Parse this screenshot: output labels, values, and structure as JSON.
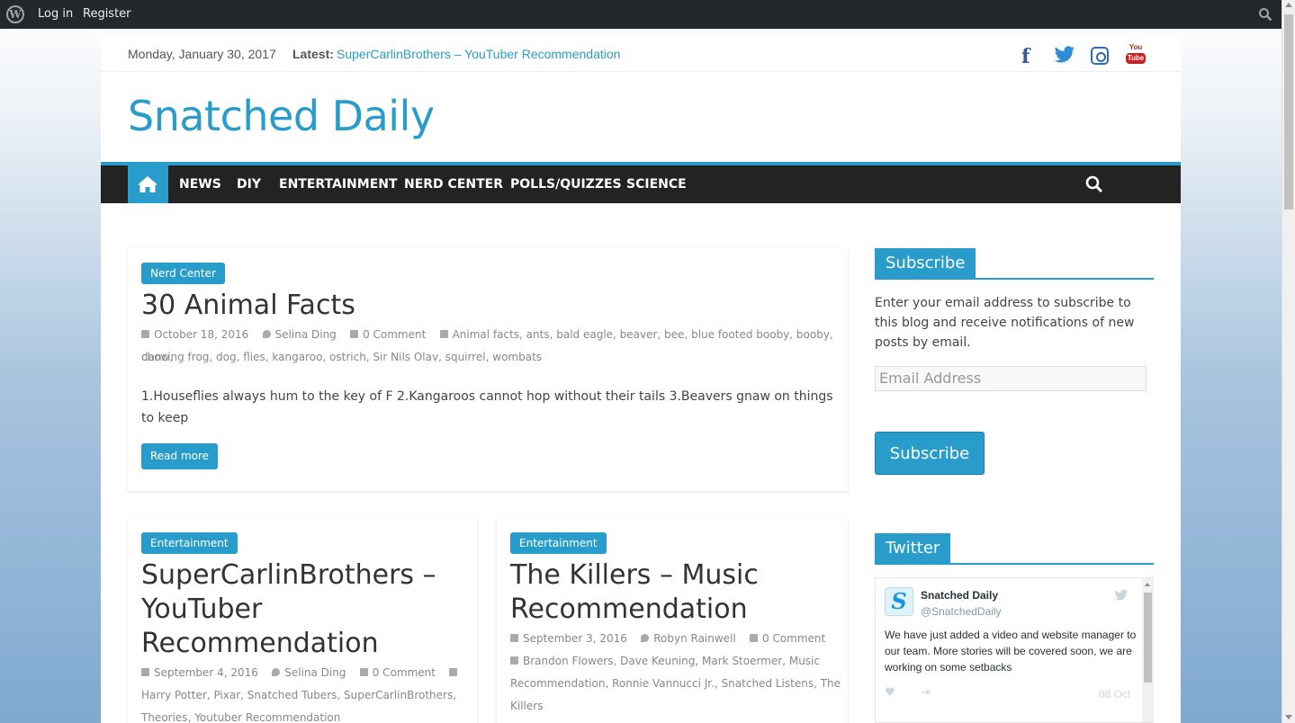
{
  "admin_bar": {
    "login": "Log in",
    "register": "Register"
  },
  "top_bar": {
    "date": "Monday, January 30, 2017",
    "latest_label": "Latest:",
    "latest_link": "SuperCarlinBrothers – YouTuber Recommendation"
  },
  "social": {
    "facebook": "f",
    "youtube_top": "You",
    "youtube_bottom": "Tube"
  },
  "site_title": "Snatched Daily",
  "nav": {
    "items": [
      "NEWS",
      "DIY",
      "ENTERTAINMENT",
      "NERD CENTER",
      "POLLS/QUIZZES",
      "SCIENCE"
    ]
  },
  "posts": [
    {
      "category": "Nerd Center",
      "title": "30 Animal Facts",
      "date": "October 18, 2016",
      "author": "Selina Ding",
      "comments": "0 Comment",
      "tags_line1": "Animal facts, ants, bald eagle, beaver, bee, blue footed booby, booby, chow,",
      "tags_line2": "dancing frog, dog, flies, kangaroo, ostrich, Sir Nils Olav, squirrel, wombats",
      "excerpt_line1": "1.Houseflies always hum to the key of F 2.Kangaroos cannot hop without their tails 3.Beavers gnaw on things",
      "excerpt_line2": "to keep",
      "read_more": "Read more"
    },
    {
      "category": "Entertainment",
      "title_line1": "SuperCarlinBrothers –",
      "title_line2": "YouTuber",
      "title_line3": "Recommendation",
      "date": "September 4, 2016",
      "author": "Selina Ding",
      "comments": "0 Comment",
      "tags_line1": "Harry Potter, Pixar, Snatched Tubers, SuperCarlinBrothers,",
      "tags_line2": "Theories, Youtuber Recommendation"
    },
    {
      "category": "Entertainment",
      "title_line1": "The Killers – Music",
      "title_line2": "Recommendation",
      "date": "September 3, 2016",
      "author": "Robyn Rainwell",
      "comments": "0 Comment",
      "tags_line1": "Brandon Flowers, Dave Keuning, Mark Stoermer, Music",
      "tags_line2": "Recommendation, Ronnie Vannucci Jr., Snatched Listens, The",
      "tags_line3": "Killers"
    }
  ],
  "sidebar": {
    "subscribe_title": "Subscribe",
    "subscribe_text": "Enter your email address to subscribe to this blog and receive notifications of new posts by email.",
    "email_placeholder": "Email Address",
    "subscribe_button": "Subscribe",
    "twitter_title": "Twitter",
    "tweet": {
      "name": "Snatched Daily",
      "handle": "@SnatchedDaily",
      "text": "We have just added a video and website manager to our team. More stories will be covered soon, we are working on some setbacks",
      "date": "08 Oct"
    }
  },
  "colors": {
    "accent": "#289dcc",
    "nav_bg": "#232323",
    "admin_bg": "#23282d"
  }
}
